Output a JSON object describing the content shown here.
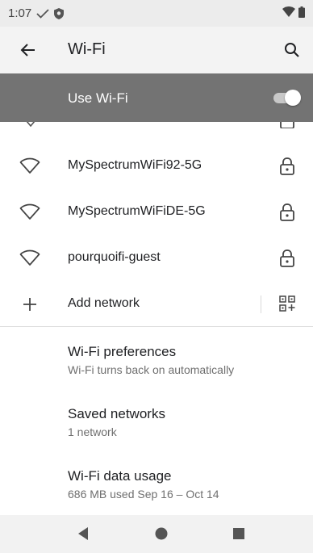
{
  "status_bar": {
    "time": "1:07",
    "icons": [
      "check-icon",
      "shield-icon",
      "wifi-signal-icon",
      "battery-icon"
    ]
  },
  "toolbar": {
    "back_icon": "arrow-back-icon",
    "title": "Wi-Fi",
    "search_icon": "search-icon"
  },
  "master_switch": {
    "label": "Use Wi-Fi",
    "state": "on"
  },
  "networks": [
    {
      "name": "MySpectrumWiFi92-5G",
      "secured": true,
      "icon": "wifi-outline-icon"
    },
    {
      "name": "MySpectrumWiFiDE-5G",
      "secured": true,
      "icon": "wifi-outline-icon"
    },
    {
      "name": "pourquoifi-guest",
      "secured": true,
      "icon": "wifi-outline-icon"
    }
  ],
  "add_network": {
    "label": "Add network",
    "icon": "plus-icon",
    "qr_icon": "qr-code-scan-icon"
  },
  "preferences": [
    {
      "title": "Wi-Fi preferences",
      "subtitle": "Wi-Fi turns back on automatically"
    },
    {
      "title": "Saved networks",
      "subtitle": "1 network"
    },
    {
      "title": "Wi-Fi data usage",
      "subtitle": "686 MB used Sep 16 – Oct 14"
    }
  ],
  "nav_bar": {
    "icons": [
      "back-triangle-icon",
      "home-circle-icon",
      "recents-square-icon"
    ]
  },
  "colors": {
    "master_bar": "#737373",
    "toolbar_bg": "#f3f3f3",
    "status_bg": "#ececec",
    "text_primary": "#202124",
    "text_secondary": "#6f6f6f"
  }
}
